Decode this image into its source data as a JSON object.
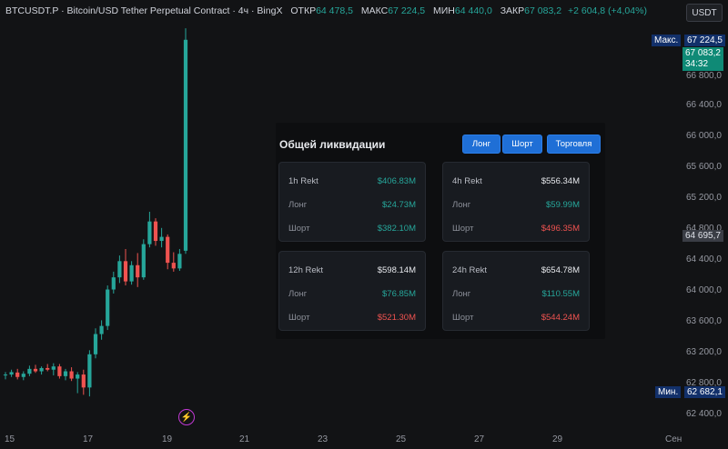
{
  "header": {
    "symbol_line": "BTCUSDT.P · Bitcoin/USD Tether Perpetual Contract · 4ч · BingX",
    "open_label": "ОТКР",
    "open_value": "64 478,5",
    "high_label": "МАКС",
    "high_value": "67 224,5",
    "low_label": "МИН",
    "low_value": "64 440,0",
    "close_label": "ЗАКР",
    "close_value": "67 083,2",
    "change": "+2 604,8 (+4,04%)"
  },
  "currency": "USDT",
  "price_axis": {
    "ticks": [
      "66 800,0",
      "66 400,0",
      "66 000,0",
      "65 600,0",
      "65 200,0",
      "64 800,0",
      "64 400,0",
      "64 000,0",
      "63 600,0",
      "63 200,0",
      "62 800,0",
      "62 400,0"
    ],
    "max_label": "Макс.",
    "max_value": "67 224,5",
    "last_price": "67 083,2",
    "countdown": "34:32",
    "crosshair_price": "64 695,7",
    "min_label": "Мин.",
    "min_value": "62 682,1"
  },
  "time_axis": [
    "15",
    "17",
    "19",
    "21",
    "23",
    "25",
    "27",
    "29",
    "Сен"
  ],
  "chart_data": {
    "type": "candlestick",
    "ylim": [
      62300,
      67350
    ],
    "candles": [
      {
        "o": 62940,
        "h": 62980,
        "l": 62890,
        "c": 62950
      },
      {
        "o": 62950,
        "h": 63010,
        "l": 62920,
        "c": 62980
      },
      {
        "o": 62975,
        "h": 63020,
        "l": 62890,
        "c": 62920
      },
      {
        "o": 62920,
        "h": 62990,
        "l": 62880,
        "c": 62960
      },
      {
        "o": 62960,
        "h": 63060,
        "l": 62930,
        "c": 63020
      },
      {
        "o": 63020,
        "h": 63070,
        "l": 62970,
        "c": 62990
      },
      {
        "o": 62990,
        "h": 63050,
        "l": 62950,
        "c": 63030
      },
      {
        "o": 63030,
        "h": 63080,
        "l": 62990,
        "c": 63010
      },
      {
        "o": 63010,
        "h": 63090,
        "l": 62940,
        "c": 63050
      },
      {
        "o": 63050,
        "h": 63080,
        "l": 62900,
        "c": 62930
      },
      {
        "o": 62930,
        "h": 63020,
        "l": 62880,
        "c": 62990
      },
      {
        "o": 62990,
        "h": 63040,
        "l": 62870,
        "c": 62900
      },
      {
        "o": 62900,
        "h": 62980,
        "l": 62720,
        "c": 62950
      },
      {
        "o": 62950,
        "h": 63010,
        "l": 62700,
        "c": 62790
      },
      {
        "o": 62790,
        "h": 63250,
        "l": 62680,
        "c": 63200
      },
      {
        "o": 63200,
        "h": 63520,
        "l": 63150,
        "c": 63450
      },
      {
        "o": 63450,
        "h": 63620,
        "l": 63380,
        "c": 63550
      },
      {
        "o": 63550,
        "h": 64050,
        "l": 63500,
        "c": 64000
      },
      {
        "o": 64000,
        "h": 64220,
        "l": 63950,
        "c": 64150
      },
      {
        "o": 64150,
        "h": 64420,
        "l": 64080,
        "c": 64350
      },
      {
        "o": 64350,
        "h": 64500,
        "l": 64050,
        "c": 64100
      },
      {
        "o": 64100,
        "h": 64350,
        "l": 64060,
        "c": 64300
      },
      {
        "o": 64300,
        "h": 64450,
        "l": 64030,
        "c": 64150
      },
      {
        "o": 64150,
        "h": 64620,
        "l": 64120,
        "c": 64560
      },
      {
        "o": 64560,
        "h": 64960,
        "l": 64520,
        "c": 64840
      },
      {
        "o": 64840,
        "h": 64880,
        "l": 64540,
        "c": 64600
      },
      {
        "o": 64600,
        "h": 64760,
        "l": 64520,
        "c": 64650
      },
      {
        "o": 64650,
        "h": 64680,
        "l": 64250,
        "c": 64330
      },
      {
        "o": 64330,
        "h": 64460,
        "l": 64220,
        "c": 64260
      },
      {
        "o": 64260,
        "h": 64500,
        "l": 64230,
        "c": 64440
      },
      {
        "o": 64478.5,
        "h": 67224.5,
        "l": 64440,
        "c": 67083.2
      }
    ]
  },
  "liquidation": {
    "title": "Общей ликвидации",
    "buttons": [
      "Лонг",
      "Шорт",
      "Торговля"
    ],
    "cards": [
      {
        "period": "1h Rekt",
        "total": "$406.83M",
        "long_label": "Лонг",
        "long": "$24.73M",
        "short_label": "Шорт",
        "short": "$382.10M"
      },
      {
        "period": "4h Rekt",
        "total": "$556.34M",
        "long_label": "Лонг",
        "long": "$59.99M",
        "short_label": "Шорт",
        "short": "$496.35M"
      },
      {
        "period": "12h Rekt",
        "total": "$598.14M",
        "long_label": "Лонг",
        "long": "$76.85M",
        "short_label": "Шорт",
        "short": "$521.30M"
      },
      {
        "period": "24h Rekt",
        "total": "$654.78M",
        "long_label": "Лонг",
        "long": "$110.55M",
        "short_label": "Шорт",
        "short": "$544.24M"
      }
    ]
  },
  "colors": {
    "up": "#26a69a",
    "down": "#ef5350",
    "accent": "#1f6fd6",
    "background": "#121315"
  },
  "icons": {
    "alert": "lightning-bolt-icon"
  }
}
